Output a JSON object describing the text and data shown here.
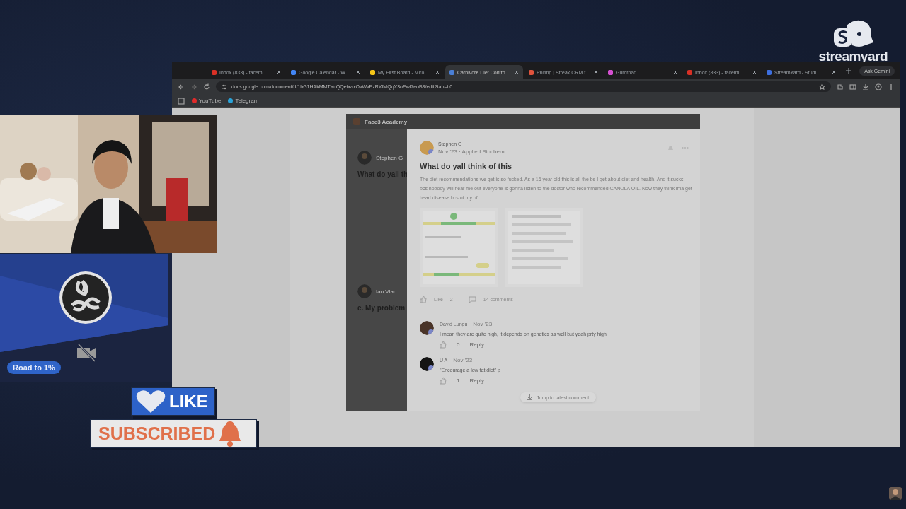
{
  "branding": {
    "name": "streamyard"
  },
  "browser": {
    "tabs": [
      {
        "title": "Inbox (833) - facemi",
        "selected": false,
        "color": "#d93025"
      },
      {
        "title": "Google Calendar - W",
        "selected": false,
        "color": "#4285f4"
      },
      {
        "title": "My First Board - Miro",
        "selected": false,
        "color": "#f5c518"
      },
      {
        "title": "Carnivore Diet Contro",
        "selected": true,
        "color": "#4a7fd6"
      },
      {
        "title": "Pricing | Streak CRM f",
        "selected": false,
        "color": "#e0533c"
      },
      {
        "title": "Gumroad",
        "selected": false,
        "color": "#d54fd0"
      },
      {
        "title": "Inbox (833) - facemi",
        "selected": false,
        "color": "#d93025"
      },
      {
        "title": "StreamYard - Studi",
        "selected": false,
        "color": "#3d6fe0"
      }
    ],
    "ask_button": "Ask Gemini",
    "address": "docs.google.com/document/d/1bG1HAkMMTYcQQetxaxOvWvEzRXfMQqX3oEwl7eoB8/edit?tab=t.0",
    "bookmarks": [
      {
        "label": "YouTube",
        "color": "#e02a2a"
      },
      {
        "label": "Telegram",
        "color": "#2aa3d9"
      }
    ]
  },
  "community": {
    "header": "Face3 Academy",
    "feed": [
      {
        "author": "Stephen G",
        "title": "What do yall th"
      },
      {
        "author": "Ian Vlad",
        "title": "e. My problem"
      }
    ],
    "post": {
      "author": "Stephen G",
      "meta": "Nov '23 · Applied Biochem",
      "title": "What do yall think of this",
      "body": "The diet recommendations we get is so fucked. As a 16 year old this is all the bs I get about diet and health. And it sucks bcs nobody will hear me out everyone is gonna listen to the doctor who recommended CANOLA OIL. Now they think ima get heart disease bcs of my bf",
      "like": "Like",
      "likes": "2",
      "comments": "14 comments"
    },
    "comments": [
      {
        "author": "David Lungu",
        "time": "Nov '23",
        "text": "I mean they are quite high, it depends on genetics as well but yeah prty high",
        "likes": "0",
        "reply": "Reply"
      },
      {
        "author": "U A",
        "time": "Nov '23",
        "text": "\"Encourage a low fat diet\" p",
        "likes": "1",
        "reply": "Reply"
      }
    ],
    "jump": "Jump to latest comment"
  },
  "overlay": {
    "badge": "Road to 1%",
    "like": "LIKE",
    "subscribe": "SUBSCRIBED"
  }
}
